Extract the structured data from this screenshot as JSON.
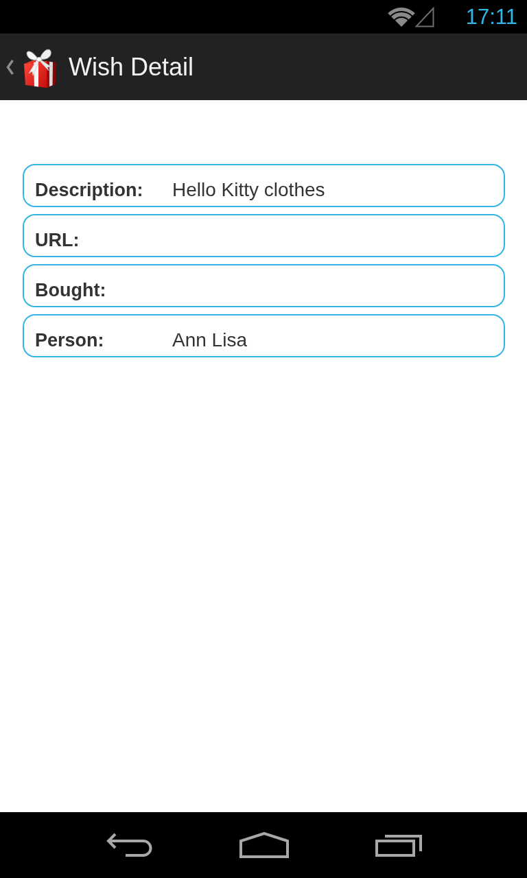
{
  "status_bar": {
    "time": "17:11"
  },
  "action_bar": {
    "title": "Wish Detail"
  },
  "details": [
    {
      "label": "Description:",
      "value": "Hello Kitty clothes"
    },
    {
      "label": "URL:"
    },
    {
      "label": "Bought:"
    },
    {
      "label": "Person:",
      "value": "Ann Lisa"
    }
  ]
}
